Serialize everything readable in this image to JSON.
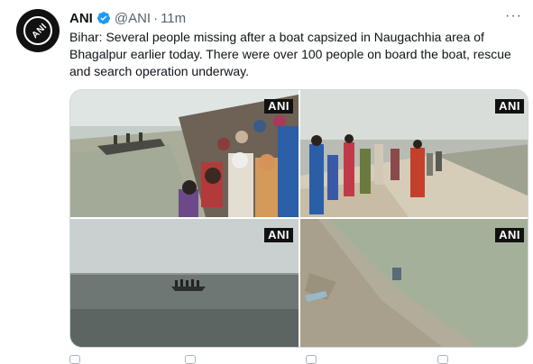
{
  "tweet": {
    "author_name": "ANI",
    "handle": "@ANI",
    "separator": "·",
    "time": "11m",
    "avatar_text": "ANI",
    "more": "···",
    "text": "Bihar: Several people missing after a boat capsized in Naugachhia area of Bhagalpur earlier today. There were over 100 people on board the boat, rescue and search operation underway."
  },
  "media": {
    "watermarks": [
      "ANI",
      "ANI",
      "ANI",
      "ANI"
    ]
  },
  "icons": {
    "verified": "verified-badge-icon",
    "more": "more-options-icon"
  },
  "colors": {
    "verified": "#1d9bf0",
    "secondary_text": "#536471",
    "border": "#cfd9de"
  }
}
